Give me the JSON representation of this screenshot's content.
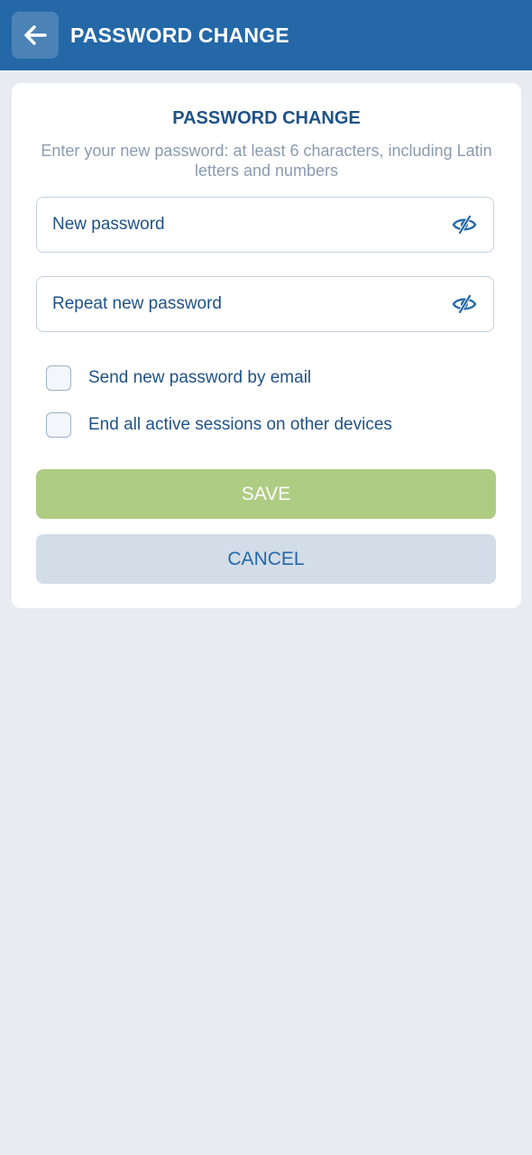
{
  "header": {
    "title": "PASSWORD CHANGE",
    "back_icon": "arrow-left-icon"
  },
  "form": {
    "title": "PASSWORD CHANGE",
    "subtitle": "Enter your new password: at least 6 characters, including Latin letters and numbers",
    "new_password": {
      "placeholder": "New password",
      "value": "",
      "toggle_icon": "eye-slash-icon"
    },
    "repeat_password": {
      "placeholder": "Repeat new password",
      "value": "",
      "toggle_icon": "eye-slash-icon"
    },
    "checkboxes": [
      {
        "label": "Send new password by email",
        "checked": false
      },
      {
        "label": "End all active sessions on other devices",
        "checked": false
      }
    ],
    "save_label": "SAVE",
    "cancel_label": "CANCEL"
  },
  "colors": {
    "header_bg": "#2468a8",
    "primary_text": "#1f5287",
    "muted_text": "#8a9bb0",
    "save_button_bg": "#afcc83",
    "cancel_button_bg": "#d3dde8",
    "page_bg": "#e8ecf1"
  }
}
